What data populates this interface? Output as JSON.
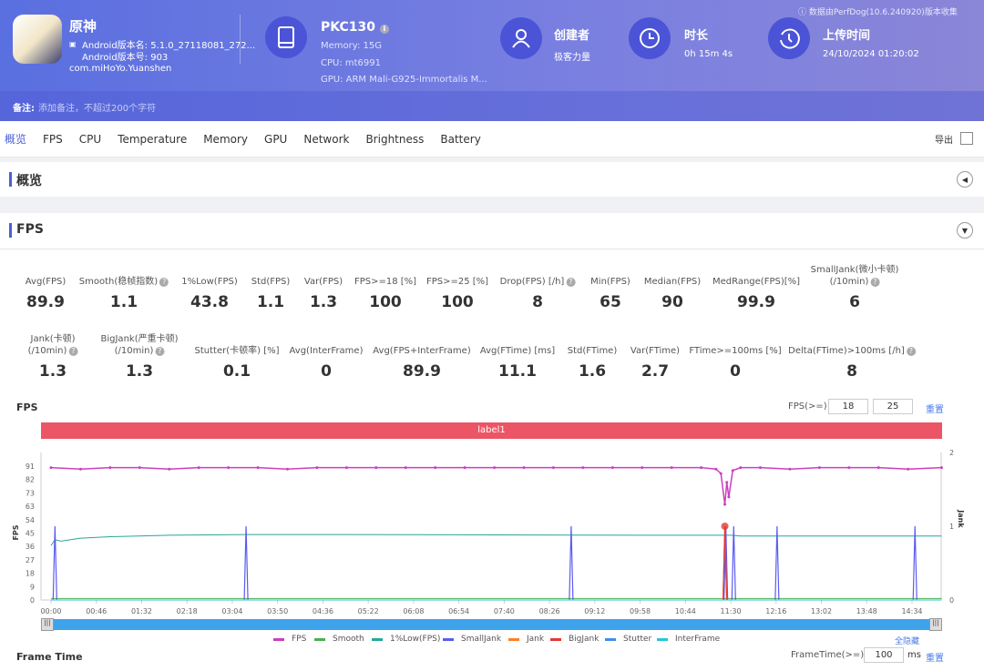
{
  "app": {
    "name": "原神",
    "version_name": "Android版本名: 5.1.0_27118081_272...",
    "version_code": "Android版本号: 903",
    "package": "com.miHoYo.Yuanshen",
    "icon_text": "miHoYo"
  },
  "device": {
    "model": "PKC130",
    "memory": "Memory: 15G",
    "cpu": "CPU: mt6991",
    "gpu": "GPU: ARM Mali-G925-Immortalis M..."
  },
  "creator": {
    "label": "创建者",
    "value": "极客力量"
  },
  "duration": {
    "label": "时长",
    "value": "0h 15m 4s"
  },
  "upload": {
    "label": "上传时间",
    "value": "24/10/2024 01:20:02"
  },
  "collected_by": "数据由PerfDog(10.6.240920)版本收集",
  "note": {
    "label": "备注:",
    "placeholder": "添加备注，不超过200个字符"
  },
  "tabs": [
    "概览",
    "FPS",
    "CPU",
    "Temperature",
    "Memory",
    "GPU",
    "Network",
    "Brightness",
    "Battery"
  ],
  "export_label": "导出",
  "overview_title": "概览",
  "fps_title": "FPS",
  "metrics_row1": [
    {
      "label": "Avg(FPS)",
      "value": "89.9"
    },
    {
      "label": "Smooth(稳帧指数)",
      "value": "1.1",
      "help": true
    },
    {
      "label": "1%Low(FPS)",
      "value": "43.8"
    },
    {
      "label": "Std(FPS)",
      "value": "1.1"
    },
    {
      "label": "Var(FPS)",
      "value": "1.3"
    },
    {
      "label": "FPS>=18 [%]",
      "value": "100"
    },
    {
      "label": "FPS>=25 [%]",
      "value": "100"
    },
    {
      "label": "Drop(FPS) [/h]",
      "value": "8",
      "help": true
    },
    {
      "label": "Min(FPS)",
      "value": "65"
    },
    {
      "label": "Median(FPS)",
      "value": "90"
    },
    {
      "label": "MedRange(FPS)[%]",
      "value": "99.9"
    },
    {
      "label": "SmallJank(微小卡顿)",
      "label2": "(/10min)",
      "value": "6",
      "help": true
    }
  ],
  "metrics_row2": [
    {
      "label": "Jank(卡顿)",
      "label2": "(/10min)",
      "value": "1.3",
      "help": true
    },
    {
      "label": "BigJank(严重卡顿)",
      "label2": "(/10min)",
      "value": "1.3",
      "help": true
    },
    {
      "label": "Stutter(卡顿率) [%]",
      "value": "0.1"
    },
    {
      "label": "Avg(InterFrame)",
      "value": "0"
    },
    {
      "label": "Avg(FPS+InterFrame)",
      "value": "89.9"
    },
    {
      "label": "Avg(FTime) [ms]",
      "value": "11.1"
    },
    {
      "label": "Std(FTime)",
      "value": "1.6"
    },
    {
      "label": "Var(FTime)",
      "value": "2.7"
    },
    {
      "label": "FTime>=100ms [%]",
      "value": "0"
    },
    {
      "label": "Delta(FTime)>100ms [/h]",
      "value": "8",
      "help": true
    }
  ],
  "fps_chart": {
    "title": "FPS",
    "threshold_label": "FPS(>=)",
    "threshold1": "18",
    "threshold2": "25",
    "reset": "重置",
    "band_label": "label1",
    "hide_all": "全隐藏"
  },
  "frametime": {
    "title": "Frame Time",
    "label": "FrameTime(>=)",
    "value": "100",
    "unit": "ms",
    "reset": "重置"
  },
  "chart_data": {
    "type": "line",
    "ylabel": "FPS",
    "y2label": "Jank",
    "yticks": [
      0,
      9,
      18,
      27,
      36,
      45,
      54,
      63,
      73,
      82,
      91
    ],
    "y2ticks": [
      0,
      1,
      2
    ],
    "xticks": [
      "00:00",
      "00:46",
      "01:32",
      "02:18",
      "03:04",
      "03:50",
      "04:36",
      "05:22",
      "06:08",
      "06:54",
      "07:40",
      "08:26",
      "09:12",
      "09:58",
      "10:44",
      "11:30",
      "12:16",
      "13:02",
      "13:48",
      "14:34"
    ],
    "x_unit": "seconds",
    "xlim": [
      0,
      904
    ],
    "ylim": [
      0,
      100
    ],
    "y2lim": [
      0,
      2
    ],
    "colors": {
      "FPS": "#cc3fbf",
      "Smooth": "#4caf50",
      "1%Low(FPS)": "#26a69a",
      "SmallJank": "#5b5bf0",
      "Jank": "#ff7f27",
      "BigJank": "#e53935",
      "Stutter": "#3f8cf0",
      "InterFrame": "#26c6da"
    },
    "series": [
      {
        "name": "FPS",
        "x": [
          0,
          30,
          60,
          90,
          120,
          150,
          180,
          210,
          240,
          270,
          300,
          330,
          360,
          390,
          420,
          450,
          480,
          510,
          540,
          570,
          600,
          630,
          660,
          675,
          680,
          684,
          686,
          688,
          692,
          700,
          720,
          750,
          780,
          810,
          840,
          870,
          904
        ],
        "y": [
          90,
          89,
          90,
          90,
          89,
          90,
          90,
          90,
          89,
          90,
          90,
          90,
          90,
          90,
          90,
          90,
          90,
          90,
          90,
          90,
          90,
          90,
          90,
          89,
          86,
          65,
          80,
          70,
          88,
          90,
          90,
          89,
          90,
          90,
          90,
          89,
          90
        ]
      },
      {
        "name": "Smooth",
        "x": [
          0,
          904
        ],
        "y": [
          1,
          1
        ]
      },
      {
        "name": "1%Low(FPS)",
        "x": [
          0,
          4,
          10,
          30,
          60,
          120,
          200,
          300,
          450,
          600,
          690,
          700,
          800,
          904
        ],
        "y": [
          37,
          41,
          40,
          42,
          43,
          44,
          44.5,
          44.5,
          44.3,
          44,
          44,
          43.5,
          43.5,
          43.5
        ]
      },
      {
        "name": "SmallJank",
        "axis": "right",
        "spikes": [
          4,
          198,
          528,
          685,
          693,
          737,
          877
        ],
        "value": 1
      },
      {
        "name": "Jank",
        "axis": "right",
        "spikes": [
          684
        ],
        "value": 1
      },
      {
        "name": "BigJank",
        "axis": "right",
        "spikes": [
          684
        ],
        "value": 1
      },
      {
        "name": "Stutter",
        "axis": "right",
        "spikes": [],
        "value": 0
      },
      {
        "name": "InterFrame",
        "x": [
          0,
          904
        ],
        "y": [
          0,
          0
        ]
      }
    ]
  }
}
